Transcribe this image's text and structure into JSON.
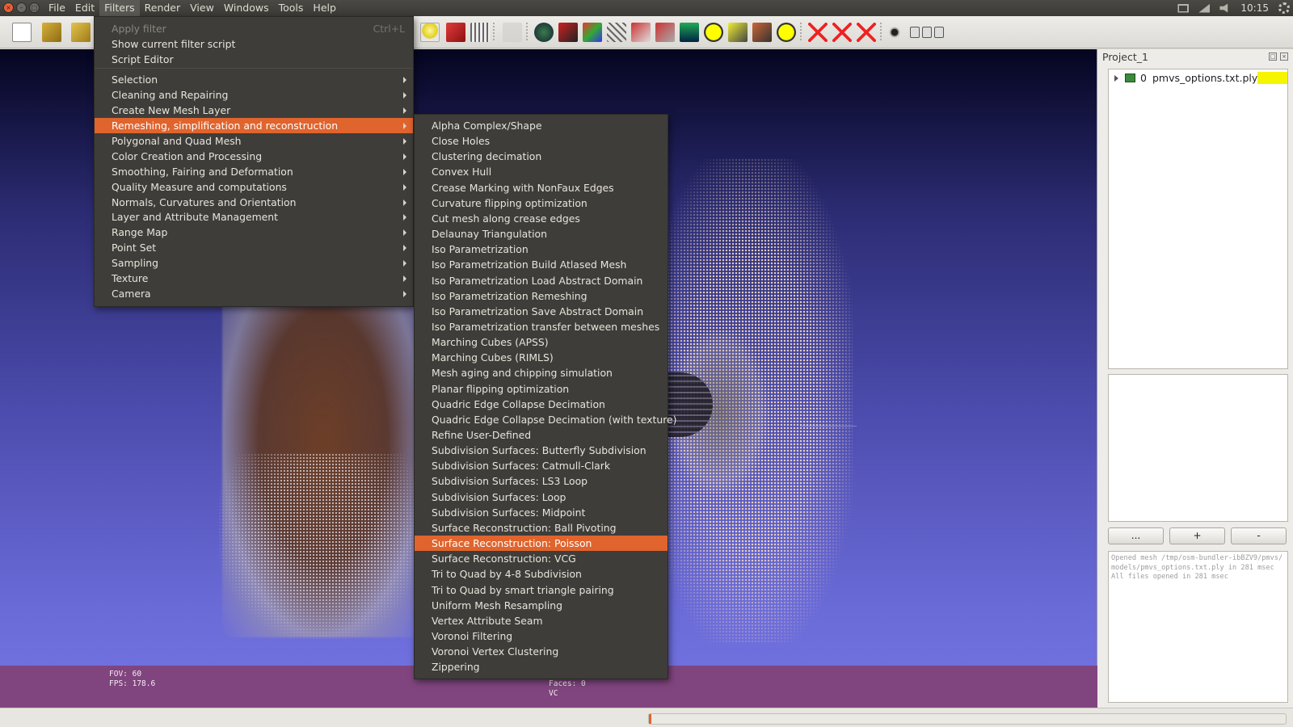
{
  "topbar": {
    "menus": [
      "File",
      "Edit",
      "Filters",
      "Render",
      "View",
      "Windows",
      "Tools",
      "Help"
    ],
    "time": "10:15"
  },
  "filters_menu": {
    "items": [
      {
        "label": "Apply filter",
        "shortcut": "Ctrl+L",
        "disabled": true
      },
      {
        "label": "Show current filter script"
      },
      {
        "label": "Script Editor"
      },
      {
        "label": "Selection",
        "submenu": true
      },
      {
        "label": "Cleaning and Repairing",
        "submenu": true
      },
      {
        "label": "Create New Mesh Layer",
        "submenu": true
      },
      {
        "label": "Remeshing, simplification and reconstruction",
        "submenu": true,
        "highlighted": true
      },
      {
        "label": "Polygonal and Quad Mesh",
        "submenu": true
      },
      {
        "label": "Color Creation and Processing",
        "submenu": true
      },
      {
        "label": "Smoothing, Fairing and Deformation",
        "submenu": true
      },
      {
        "label": "Quality Measure and computations",
        "submenu": true
      },
      {
        "label": "Normals, Curvatures and Orientation",
        "submenu": true
      },
      {
        "label": "Layer and Attribute Management",
        "submenu": true
      },
      {
        "label": "Range Map",
        "submenu": true
      },
      {
        "label": "Point Set",
        "submenu": true
      },
      {
        "label": "Sampling",
        "submenu": true
      },
      {
        "label": "Texture",
        "submenu": true
      },
      {
        "label": "Camera",
        "submenu": true
      }
    ]
  },
  "remesh_submenu": {
    "items": [
      "Alpha Complex/Shape",
      "Close Holes",
      "Clustering decimation",
      "Convex Hull",
      "Crease Marking with NonFaux Edges",
      "Curvature flipping optimization",
      "Cut mesh along crease edges",
      "Delaunay Triangulation",
      "Iso Parametrization",
      "Iso Parametrization Build Atlased Mesh",
      "Iso Parametrization Load Abstract Domain",
      "Iso Parametrization Remeshing",
      "Iso Parametrization Save Abstract Domain",
      "Iso Parametrization transfer between meshes",
      "Marching Cubes (APSS)",
      "Marching Cubes (RIMLS)",
      "Mesh aging and chipping simulation",
      "Planar flipping optimization",
      "Quadric Edge Collapse Decimation",
      "Quadric Edge Collapse Decimation (with texture)",
      "Refine User-Defined",
      "Subdivision Surfaces: Butterfly Subdivision",
      "Subdivision Surfaces: Catmull-Clark",
      "Subdivision Surfaces: LS3 Loop",
      "Subdivision Surfaces: Loop",
      "Subdivision Surfaces: Midpoint",
      "Surface Reconstruction: Ball Pivoting",
      "Surface Reconstruction: Poisson",
      "Surface Reconstruction: VCG",
      "Tri to Quad by 4-8 Subdivision",
      "Tri to Quad by smart triangle pairing",
      "Uniform Mesh Resampling",
      "Vertex Attribute Seam",
      "Voronoi Filtering",
      "Voronoi Vertex Clustering",
      "Zippering"
    ],
    "highlighted_index": 27
  },
  "viewport": {
    "fov": "FOV: 60",
    "fps": "FPS:   178.6",
    "faces": "Faces: 0",
    "vc": "VC"
  },
  "right_panel": {
    "project_title": "Project_1",
    "layer": {
      "index": "0",
      "name": "pmvs_options.txt.ply",
      "color": "#f5f500"
    },
    "buttons": [
      "...",
      "+",
      "-"
    ],
    "log": [
      "Opened mesh /tmp/osm-bundler-ibBZV9/pmvs/models/pmvs_options.txt.ply in 281 msec",
      "All files opened in 281 msec"
    ]
  },
  "progress": {
    "fraction": 0.004
  },
  "colors": {
    "accent": "#e0642d",
    "menu_bg": "#3e3d39"
  },
  "toolbar_icons": [
    "new-file-icon",
    "open-project-icon",
    "open-folder-icon",
    "light-bulb-icon",
    "smooth-shading-icon",
    "texture-icon",
    "pick-icon",
    "globe-icon",
    "paint-icon",
    "color-icon",
    "select-faces-icon",
    "select-vertices-icon",
    "select-region-icon",
    "raster-icon",
    "annotation-icon",
    "brush-icon",
    "pencil-icon",
    "info-icon",
    "delete-faces-icon",
    "delete-vertices-icon",
    "delete-all-icon",
    "eye-icon",
    "minimize-icon",
    "restore-icon",
    "close-icon"
  ]
}
